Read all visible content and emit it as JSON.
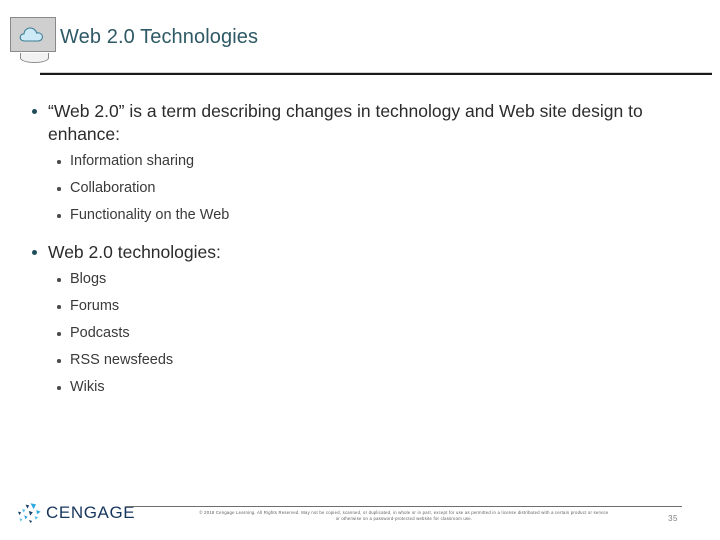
{
  "slide": {
    "title": "Web 2.0 Technologies",
    "title_icon": "cloud-monitor-icon",
    "title_color": "#2e5965",
    "accent_color": "#1f4e5a",
    "background": "#ffffff"
  },
  "content": {
    "blocks": [
      {
        "level1": "“Web 2.0” is a term describing changes in technology and Web site design to enhance:",
        "level2": [
          "Information sharing",
          "Collaboration",
          "Functionality on the Web"
        ]
      },
      {
        "level1": "Web 2.0 technologies:",
        "level2": [
          "Blogs",
          "Forums",
          "Podcasts",
          "RSS newsfeeds",
          "Wikis"
        ]
      }
    ]
  },
  "footer": {
    "logo_text": "CENGAGE",
    "logo_mark": "cengage-swirl-icon",
    "logo_color": "#17365d",
    "copyright_line1": "© 2018 Cengage Learning. All Rights Reserved. May not be copied, scanned, or duplicated, in whole or in part, except for use as permitted in a license distributed with a certain product or service",
    "copyright_line2": "or otherwise on a password-protected website for classroom use.",
    "page_number": "35"
  }
}
